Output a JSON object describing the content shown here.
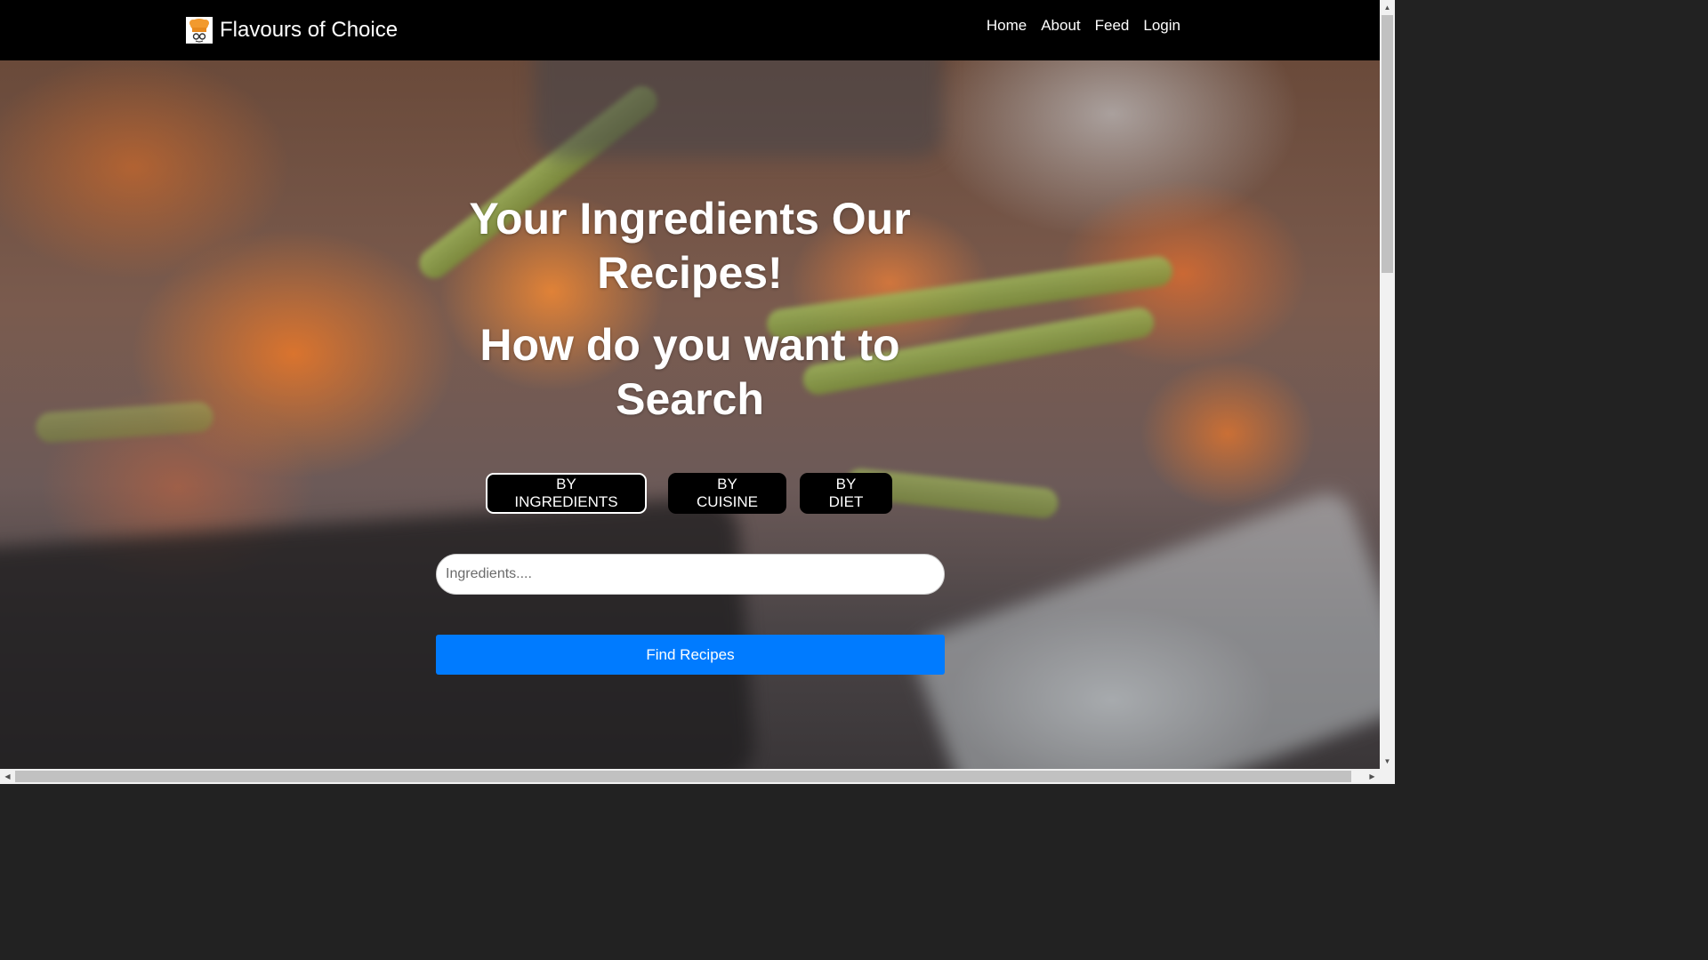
{
  "navbar": {
    "brand": "Flavours of Choice",
    "links": [
      "Home",
      "About",
      "Feed",
      "Login"
    ]
  },
  "hero": {
    "headline_1": "Your Ingredients Our Recipes!",
    "headline_2": "How do you want to Search",
    "tabs": [
      "BY INGREDIENTS",
      "BY CUISINE",
      "BY DIET"
    ],
    "active_tab": "BY INGREDIENTS",
    "search": {
      "value": "",
      "placeholder": "Ingredients...."
    },
    "submit_label": "Find Recipes"
  },
  "colors": {
    "navbar_bg": "#000000",
    "button_primary": "#007bff",
    "tab_bg": "#000000",
    "text": "#ffffff"
  },
  "icons": {
    "brand_logo": "chef-icon"
  }
}
